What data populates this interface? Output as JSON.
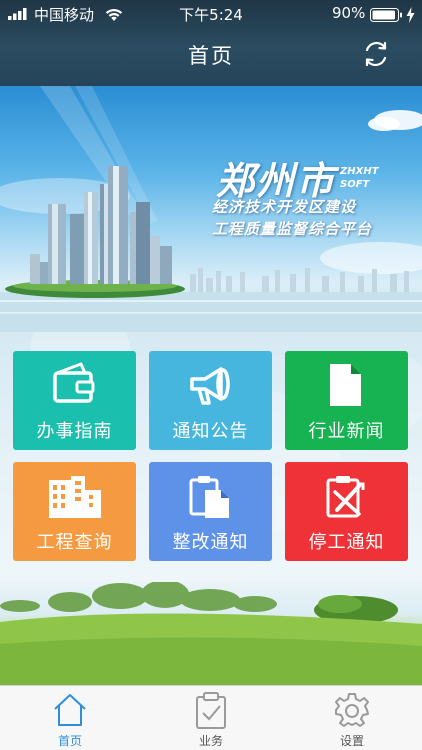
{
  "status_bar": {
    "carrier": "中国移动",
    "time": "下午5:24",
    "battery": "90%"
  },
  "nav": {
    "title": "首页"
  },
  "banner": {
    "city": "郑州市",
    "brand_line1": "ZHXHT",
    "brand_line2": "SOFT",
    "subtitle_line1": "经济技术开发区建设",
    "subtitle_line2": "工程质量监督综合平台"
  },
  "tiles": [
    {
      "label": "办事指南",
      "color": "#1bbfae",
      "icon": "wallet-icon"
    },
    {
      "label": "通知公告",
      "color": "#47b6de",
      "icon": "megaphone-icon"
    },
    {
      "label": "行业新闻",
      "color": "#17b251",
      "icon": "document-icon"
    },
    {
      "label": "工程查询",
      "color": "#f59a40",
      "icon": "buildings-icon"
    },
    {
      "label": "整改通知",
      "color": "#5e92e8",
      "icon": "clipboard-icon"
    },
    {
      "label": "停工通知",
      "color": "#ef3237",
      "icon": "stop-work-icon"
    }
  ],
  "tabbar": {
    "items": [
      {
        "label": "首页",
        "icon": "home-icon",
        "active": true
      },
      {
        "label": "业务",
        "icon": "business-clipboard-icon",
        "active": false
      },
      {
        "label": "设置",
        "icon": "gear-icon",
        "active": false
      }
    ],
    "active_color": "#2d8fdc",
    "inactive_color": "#9a9a9a"
  }
}
